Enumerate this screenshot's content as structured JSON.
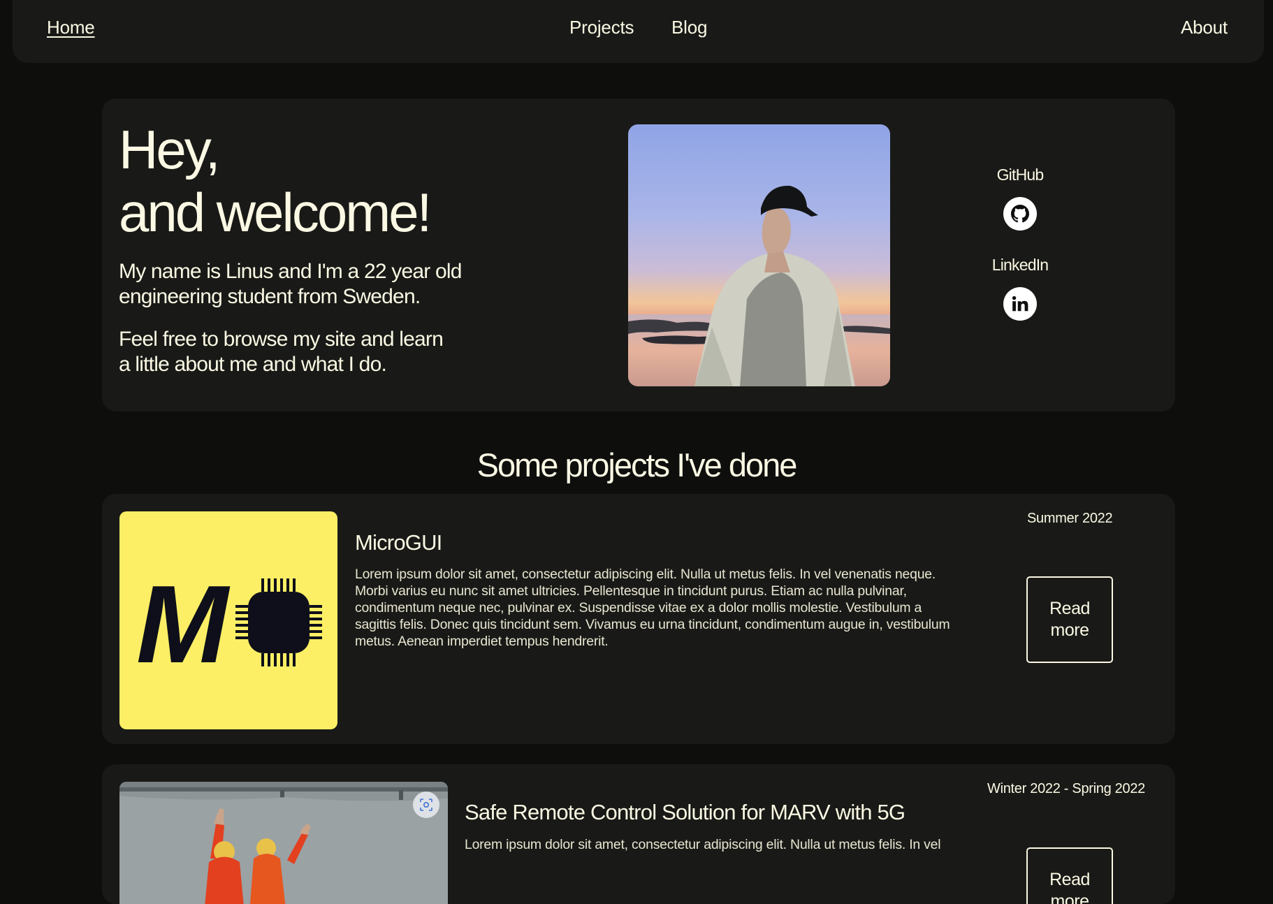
{
  "nav": {
    "home": "Home",
    "projects": "Projects",
    "blog": "Blog",
    "about": "About"
  },
  "hero": {
    "title_line1": "Hey,",
    "title_line2": "and welcome!",
    "intro_line1": "My name is Linus and I'm a 22 year old",
    "intro_line2": "engineering student from Sweden.",
    "browse_line1": "Feel free to browse my site and learn",
    "browse_line2": "a little about me and what I do."
  },
  "social": {
    "github_label": "GitHub",
    "github_icon": "github-icon",
    "linkedin_label": "LinkedIn",
    "linkedin_icon": "linkedin-icon"
  },
  "projects_section": {
    "title": "Some projects I've done",
    "items": [
      {
        "title": "MicroGUI",
        "date": "Summer 2022",
        "description": "Lorem ipsum dolor sit amet, consectetur adipiscing elit. Nulla ut metus felis. In vel venenatis neque. Morbi varius eu nunc sit amet ultricies. Pellentesque in tincidunt purus. Etiam ac nulla pulvinar, condimentum neque nec, pulvinar ex. Suspendisse vitae ex a dolor mollis molestie. Vestibulum a sagittis felis. Donec quis tincidunt sem. Vivamus eu urna tincidunt, condimentum augue in, vestibulum metus. Aenean imperdiet tempus hendrerit.",
        "button": "Read more",
        "logo_text": "M",
        "logo_color": "#fcef65"
      },
      {
        "title": "Safe Remote Control Solution for MARV with 5G",
        "date": "Winter 2022 - Spring 2022",
        "description": "Lorem ipsum dolor sit amet, consectetur adipiscing elit. Nulla ut metus felis. In vel",
        "button": "Read more"
      }
    ]
  },
  "colors": {
    "background": "#0e0f0d",
    "card": "#191a17",
    "text": "#fbf8e4",
    "accent_yellow": "#fcef65"
  }
}
